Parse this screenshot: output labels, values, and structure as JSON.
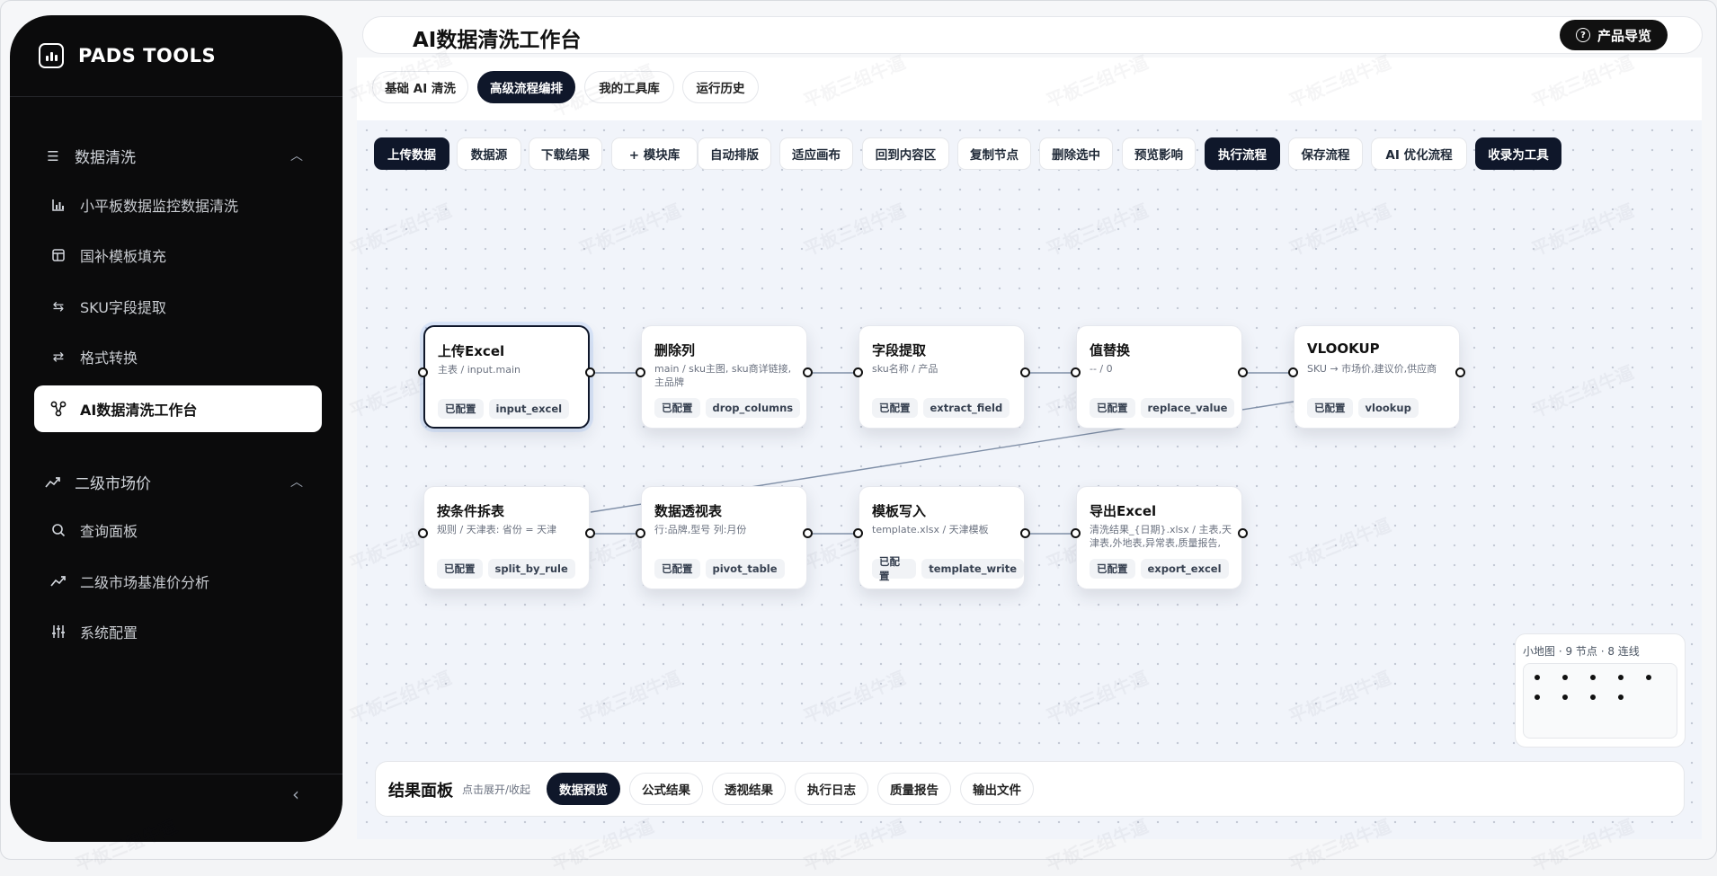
{
  "brand": {
    "name": "PADS TOOLS"
  },
  "sidebar": {
    "group1": {
      "label": "数据清洗",
      "icon": "list-icon"
    },
    "group1_items": [
      {
        "label": "小平板数据监控数据清洗",
        "icon": "bar-chart-icon"
      },
      {
        "label": "国补模板填充",
        "icon": "template-icon"
      },
      {
        "label": "SKU字段提取",
        "icon": "swap-icon"
      },
      {
        "label": "格式转换",
        "icon": "convert-icon"
      },
      {
        "label": "AI数据清洗工作台",
        "icon": "workflow-icon",
        "active": true
      }
    ],
    "group2": {
      "label": "二级市场价",
      "icon": "trend-icon"
    },
    "group2_items": [
      {
        "label": "查询面板",
        "icon": "search-icon"
      },
      {
        "label": "二级市场基准价分析",
        "icon": "trend-icon"
      },
      {
        "label": "系统配置",
        "icon": "sliders-icon"
      }
    ]
  },
  "header": {
    "title": "AI数据清洗工作台",
    "guide_label": "产品导览"
  },
  "tabs": [
    "基础 AI 清洗",
    "高级流程编排",
    "我的工具库",
    "运行历史"
  ],
  "toolbar": [
    "上传数据",
    "数据源",
    "下载结果",
    "+ 模块库",
    "自动排版",
    "适应画布",
    "回到内容区",
    "复制节点",
    "删除选中",
    "预览影响",
    "执行流程",
    "保存流程",
    "AI 优化流程",
    "收录为工具"
  ],
  "nodes": [
    {
      "title": "上传Excel",
      "sub": "主表 / input.main",
      "status": "已配置",
      "code": "input_excel"
    },
    {
      "title": "删除列",
      "sub": "main / sku主图, sku商详链接, 主品牌",
      "status": "已配置",
      "code": "drop_columns"
    },
    {
      "title": "字段提取",
      "sub": "sku名称 / 产品",
      "status": "已配置",
      "code": "extract_field"
    },
    {
      "title": "值替换",
      "sub": "-- / 0",
      "status": "已配置",
      "code": "replace_value"
    },
    {
      "title": "VLOOKUP",
      "sub": "SKU → 市场价,建议价,供应商",
      "status": "已配置",
      "code": "vlookup"
    },
    {
      "title": "按条件拆表",
      "sub": "规则 / 天津表: 省份 = 天津",
      "status": "已配置",
      "code": "split_by_rule"
    },
    {
      "title": "数据透视表",
      "sub": "行:品牌,型号 列:月份",
      "status": "已配置",
      "code": "pivot_table"
    },
    {
      "title": "模板写入",
      "sub": "template.xlsx / 天津模板",
      "status": "已配置",
      "code": "template_write"
    },
    {
      "title": "导出Excel",
      "sub": "清洗结果_{日期}.xlsx / 主表,天津表,外地表,异常表,质量报告,",
      "status": "已配置",
      "code": "export_excel"
    }
  ],
  "minimap": {
    "caption": "小地图 · 9 节点 · 8 连线"
  },
  "result_panel": {
    "title": "结果面板",
    "hint": "点击展开/收起",
    "tabs": [
      "数据预览",
      "公式结果",
      "透视结果",
      "执行日志",
      "质量报告",
      "输出文件"
    ]
  },
  "watermark": "平板三组牛逼"
}
